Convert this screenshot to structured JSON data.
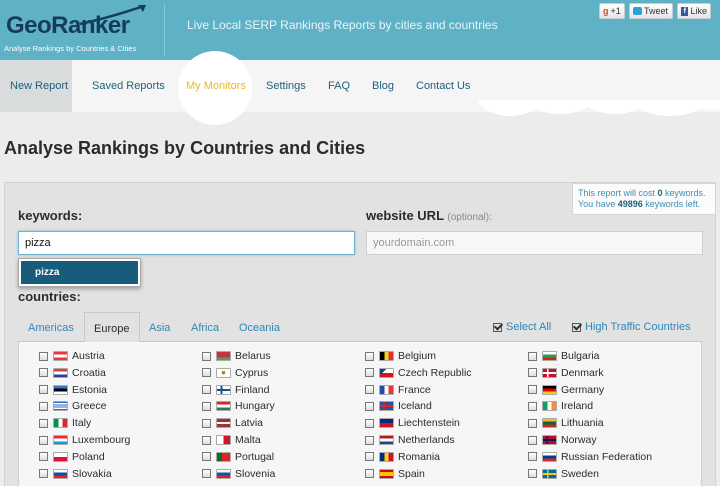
{
  "header": {
    "logo_text": "GeoRanker",
    "logo_subtitle": "Analyse Rankings by Countries & Cities",
    "tagline": "Live Local SERP Rankings Reports by cities and countries",
    "social": {
      "gplus_label": "+1",
      "tweet_label": "Tweet",
      "like_label": "Like"
    }
  },
  "nav": {
    "items": [
      {
        "label": "New Report",
        "active": true
      },
      {
        "label": "Saved Reports"
      },
      {
        "label": "My Monitors",
        "highlighted": true
      },
      {
        "label": "Settings"
      },
      {
        "label": "FAQ"
      },
      {
        "label": "Blog"
      },
      {
        "label": "Contact Us"
      }
    ]
  },
  "page": {
    "title": "Analyse Rankings by Countries and Cities"
  },
  "cost": {
    "line1_prefix": "This report will cost ",
    "line1_value": "0",
    "line1_suffix": " keywords.",
    "line2_prefix": "You have ",
    "line2_value": "49896",
    "line2_suffix": " keywords left."
  },
  "form": {
    "keywords_label": "keywords:",
    "keywords_value": "pizza",
    "url_label": "website URL",
    "url_optional": "(optional):",
    "url_placeholder": "yourdomain.com",
    "autocomplete_item": "pizza",
    "countries_label": "countries:"
  },
  "tabs": {
    "items": [
      "Americas",
      "Europe",
      "Asia",
      "Africa",
      "Oceania"
    ],
    "active": "Europe",
    "select_all": "Select All",
    "high_traffic": "High Traffic Countries"
  },
  "countries": [
    [
      "Austria",
      "Belarus",
      "Belgium",
      "Bulgaria"
    ],
    [
      "Croatia",
      "Cyprus",
      "Czech Republic",
      "Denmark"
    ],
    [
      "Estonia",
      "Finland",
      "France",
      "Germany"
    ],
    [
      "Greece",
      "Hungary",
      "Iceland",
      "Ireland"
    ],
    [
      "Italy",
      "Latvia",
      "Liechtenstein",
      "Lithuania"
    ],
    [
      "Luxembourg",
      "Malta",
      "Netherlands",
      "Norway"
    ],
    [
      "Poland",
      "Portugal",
      "Romania",
      "Russian Federation"
    ],
    [
      "Slovakia",
      "Slovenia",
      "Spain",
      "Sweden"
    ]
  ],
  "colors": {
    "header_bg": "#5fb2c6",
    "logo_text": "#173c5a",
    "nav_link": "#1e5f7a",
    "nav_highlight": "#e9b928",
    "link_blue": "#2c88b8",
    "autocomplete_bg": "#165d7c"
  }
}
